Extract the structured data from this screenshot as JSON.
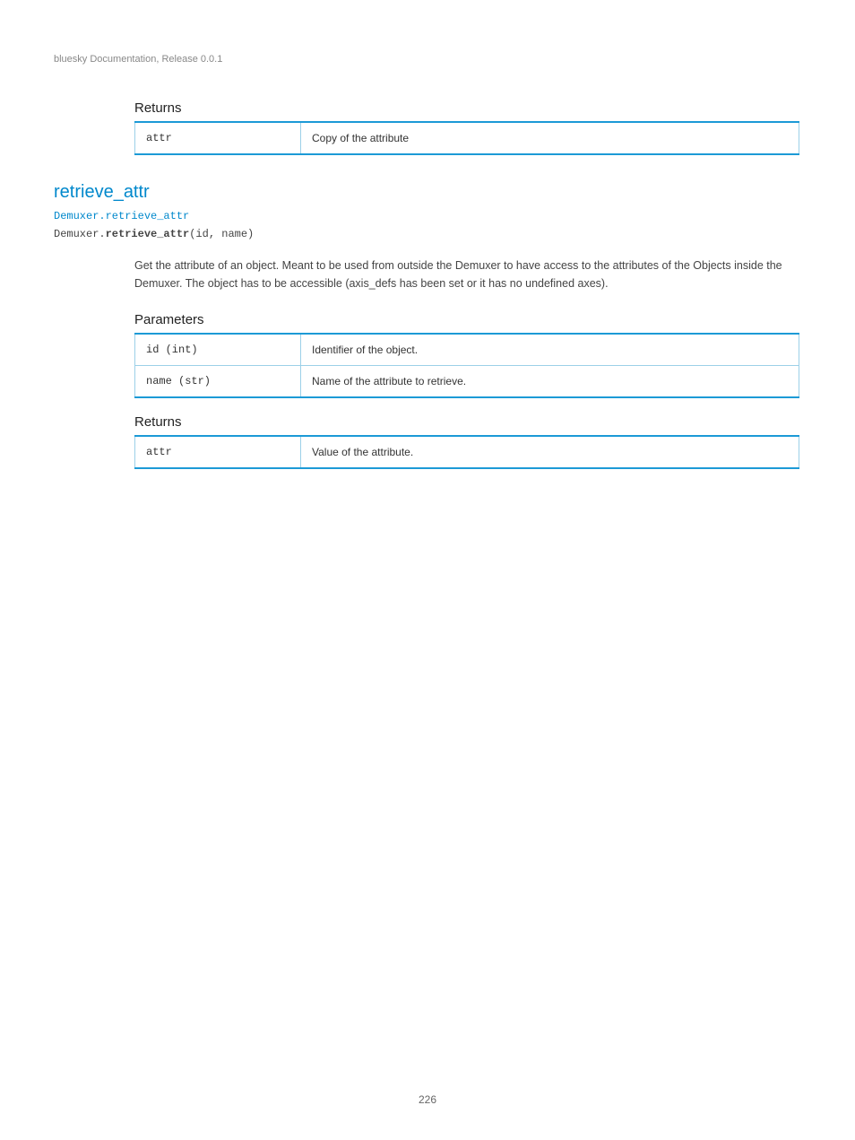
{
  "header": {
    "left": "bluesky Documentation, Release 0.0.1",
    "right": ""
  },
  "returns_table": {
    "rows": [
      {
        "k": "attr",
        "v": "Copy of the attribute"
      }
    ]
  },
  "retrieve_attr": {
    "title": "retrieve_attr",
    "parent": "Demuxer.retrieve_attr",
    "usage_prefix": "Demuxer.",
    "usage_bold": "retrieve_attr",
    "usage_args": "(id, name)",
    "desc": "Get the attribute of an object. Meant to be used from outside the Demuxer to have access to the attributes of the Objects inside the Demuxer. The object has to be accessible (axis_defs has been set or it has no undefined axes).",
    "parameters_title": "Parameters",
    "parameters": [
      {
        "k": "id (int)",
        "v": "Identifier of the object."
      },
      {
        "k": "name (str)",
        "v": "Name of the attribute to retrieve."
      }
    ],
    "returns_title": "Returns",
    "returns": [
      {
        "k": "attr",
        "v": "Value of the attribute."
      }
    ]
  },
  "page_number": "226"
}
